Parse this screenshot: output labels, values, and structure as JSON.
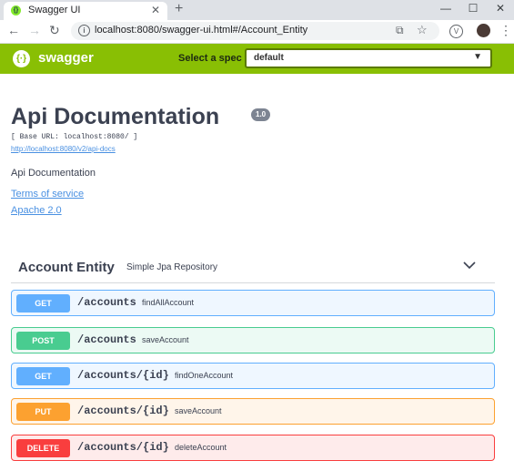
{
  "browser": {
    "tab_title": "Swagger UI",
    "url": "localhost:8080/swagger-ui.html#/Account_Entity"
  },
  "topbar": {
    "logo_text": "swagger",
    "spec_label": "Select a spec",
    "spec_value": "default"
  },
  "info": {
    "title": "Api Documentation",
    "version": "1.0",
    "base_url": "[ Base URL: localhost:8080/ ]",
    "docs_link": "http://localhost:8080/v2/api-docs",
    "description": "Api Documentation",
    "terms_link": "Terms of service",
    "license_link": "Apache 2.0"
  },
  "tag": {
    "name": "Account Entity",
    "description": "Simple Jpa Repository"
  },
  "colors": {
    "get": "#61affe",
    "post": "#49cc90",
    "put": "#fca130",
    "delete": "#f93e3e",
    "swagger_green": "#89bf04"
  },
  "operations": [
    {
      "method": "GET",
      "path": "/accounts",
      "summary": "findAllAccount"
    },
    {
      "method": "POST",
      "path": "/accounts",
      "summary": "saveAccount"
    },
    {
      "method": "GET",
      "path": "/accounts/{id}",
      "summary": "findOneAccount"
    },
    {
      "method": "PUT",
      "path": "/accounts/{id}",
      "summary": "saveAccount"
    },
    {
      "method": "DELETE",
      "path": "/accounts/{id}",
      "summary": "deleteAccount"
    }
  ]
}
